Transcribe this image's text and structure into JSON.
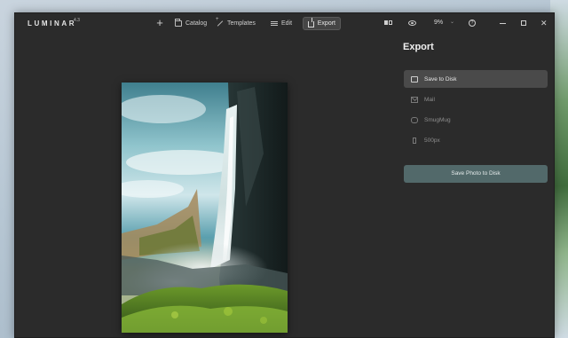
{
  "app": {
    "brand": "LUMINAR",
    "version": "4.3"
  },
  "toolbar": {
    "add_label": "+",
    "catalog_label": "Catalog",
    "templates_label": "Templates",
    "edit_label": "Edit",
    "export_label": "Export",
    "zoom_value": "9%",
    "zoom_chevron": "⌄",
    "help_glyph": "?",
    "close_glyph": "✕"
  },
  "export_panel": {
    "title": "Export",
    "options": [
      {
        "label": "Save to Disk",
        "icon": "folder-icon",
        "active": true
      },
      {
        "label": "Mail",
        "icon": "mail-icon",
        "active": false
      },
      {
        "label": "SmugMug",
        "icon": "smugmug-icon",
        "active": false
      },
      {
        "label": "500px",
        "icon": "500px-icon",
        "active": false
      }
    ],
    "save_button_label": "Save Photo to Disk"
  },
  "colors": {
    "window_bg": "#2b2b2b",
    "active_option_bg": "#4a4a4a",
    "primary_button_bg": "#52696a"
  }
}
